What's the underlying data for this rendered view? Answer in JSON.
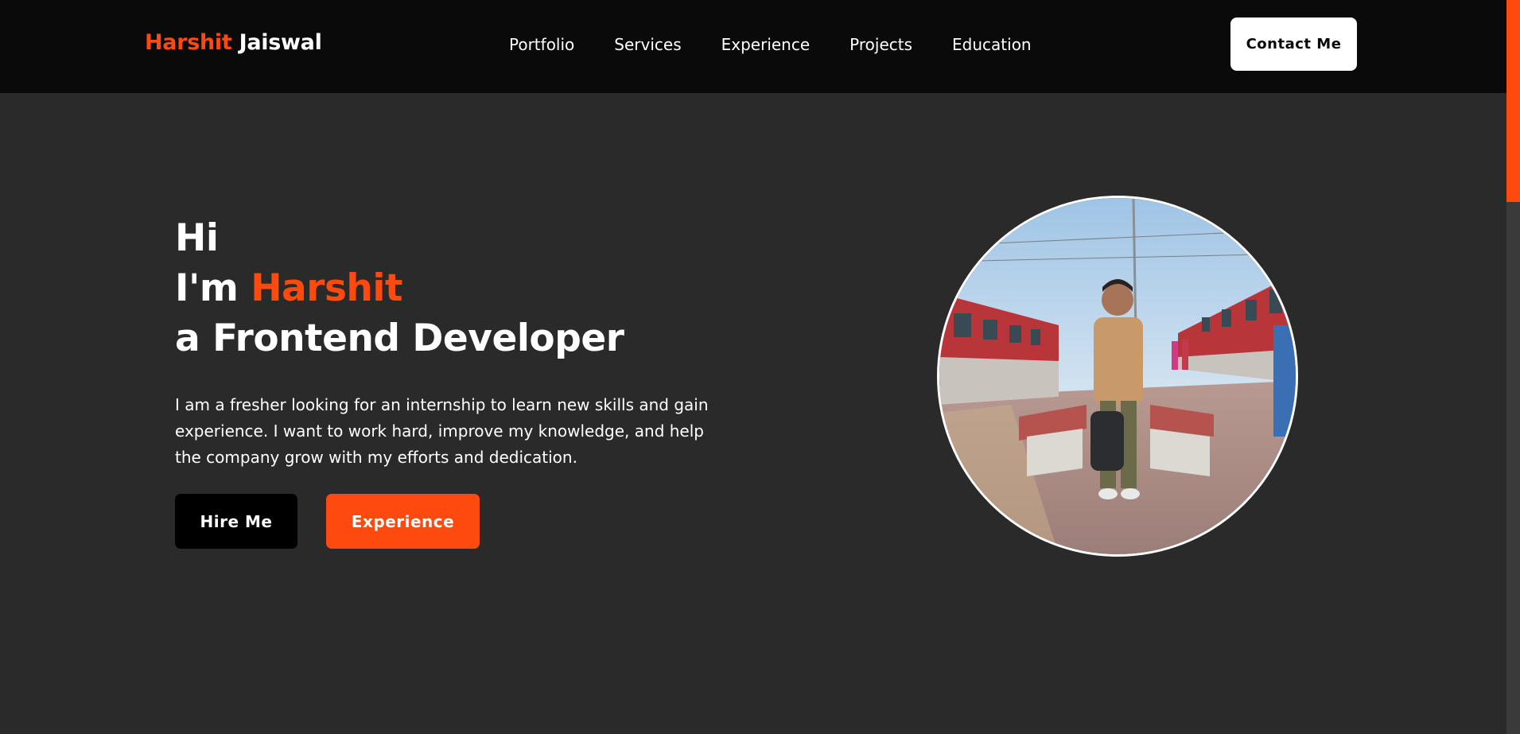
{
  "nav": {
    "brand_first": "Harshit",
    "brand_last": "Jaiswal",
    "links": [
      "Portfolio",
      "Services",
      "Experience",
      "Projects",
      "Education"
    ],
    "contact_label": "Contact Me"
  },
  "hero": {
    "line1": "Hi",
    "line2_prefix": "I'm ",
    "line2_name": "Harshit",
    "line3": "a Frontend Developer",
    "intro": "I am a fresher looking for an internship to learn new skills and gain experience. I want to work hard, improve my knowledge, and help the company grow with my efforts and dedication.",
    "hire_label": "Hire Me",
    "experience_label": "Experience"
  },
  "colors": {
    "accent": "#ff4a0f",
    "background": "#2a2a2a",
    "navbar": "#0a0a0a"
  },
  "scroll": {
    "position_fraction": 0
  }
}
